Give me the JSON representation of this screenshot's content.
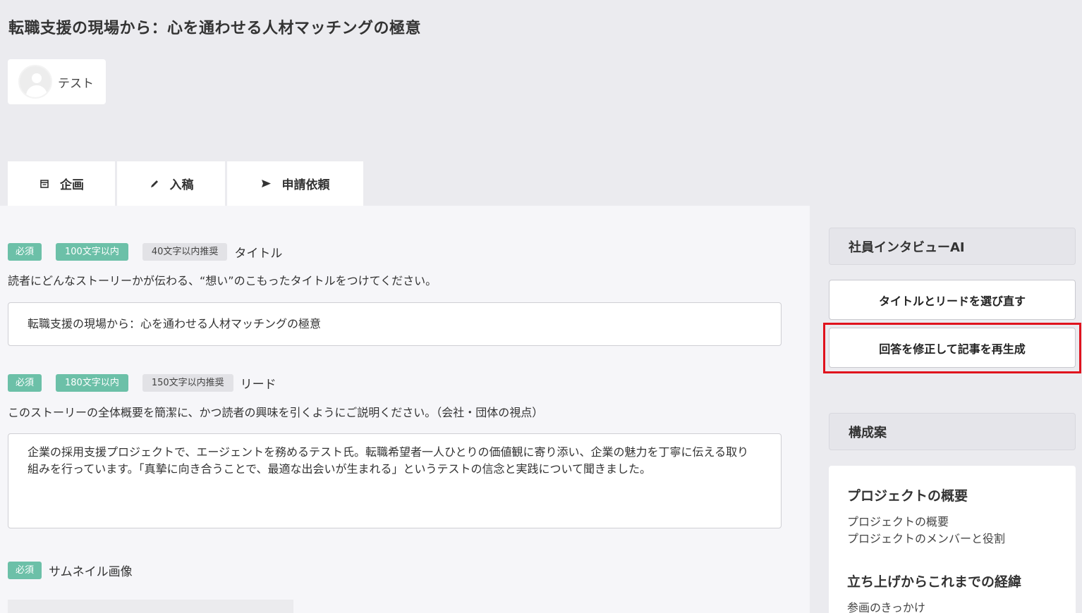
{
  "page": {
    "title": "転職支援の現場から：心を通わせる人材マッチングの極意",
    "author": "テスト"
  },
  "tabs": [
    {
      "label": "企画",
      "icon": "calendar-icon"
    },
    {
      "label": "入稿",
      "icon": "pencil-icon"
    },
    {
      "label": "申請依頼",
      "icon": "send-icon"
    }
  ],
  "fields": {
    "title": {
      "required": "必須",
      "limit": "100文字以内",
      "recommend": "40文字以内推奨",
      "label": "タイトル",
      "description": "読者にどんなストーリーかが伝わる、“想い”のこもったタイトルをつけてください。",
      "value": "転職支援の現場から：心を通わせる人材マッチングの極意"
    },
    "lead": {
      "required": "必須",
      "limit": "180文字以内",
      "recommend": "150文字以内推奨",
      "label": "リード",
      "description": "このストーリーの全体概要を簡潔に、かつ読者の興味を引くようにご説明ください。（会社・団体の視点）",
      "value": "企業の採用支援プロジェクトで、エージェントを務めるテスト氏。転職希望者一人ひとりの価値観に寄り添い、企業の魅力を丁寧に伝える取り組みを行っています。「真摯に向き合うことで、最適な出会いが生まれる」というテストの信念と実践について聞きました。"
    },
    "thumbnail": {
      "required": "必須",
      "label": "サムネイル画像"
    }
  },
  "sidebar": {
    "ai_title": "社員インタビューAI",
    "reselect_button": "タイトルとリードを選び直す",
    "regenerate_button": "回答を修正して記事を再生成",
    "outline_title": "構成案",
    "outline": [
      {
        "heading": "プロジェクトの概要",
        "items": [
          "プロジェクトの概要",
          "プロジェクトのメンバーと役割"
        ]
      },
      {
        "heading": "立ち上げからこれまでの経緯",
        "items": [
          "参画のきっかけ"
        ]
      }
    ]
  },
  "colors": {
    "accent_green": "#6cc0a8",
    "highlight_red": "#e0121d"
  }
}
